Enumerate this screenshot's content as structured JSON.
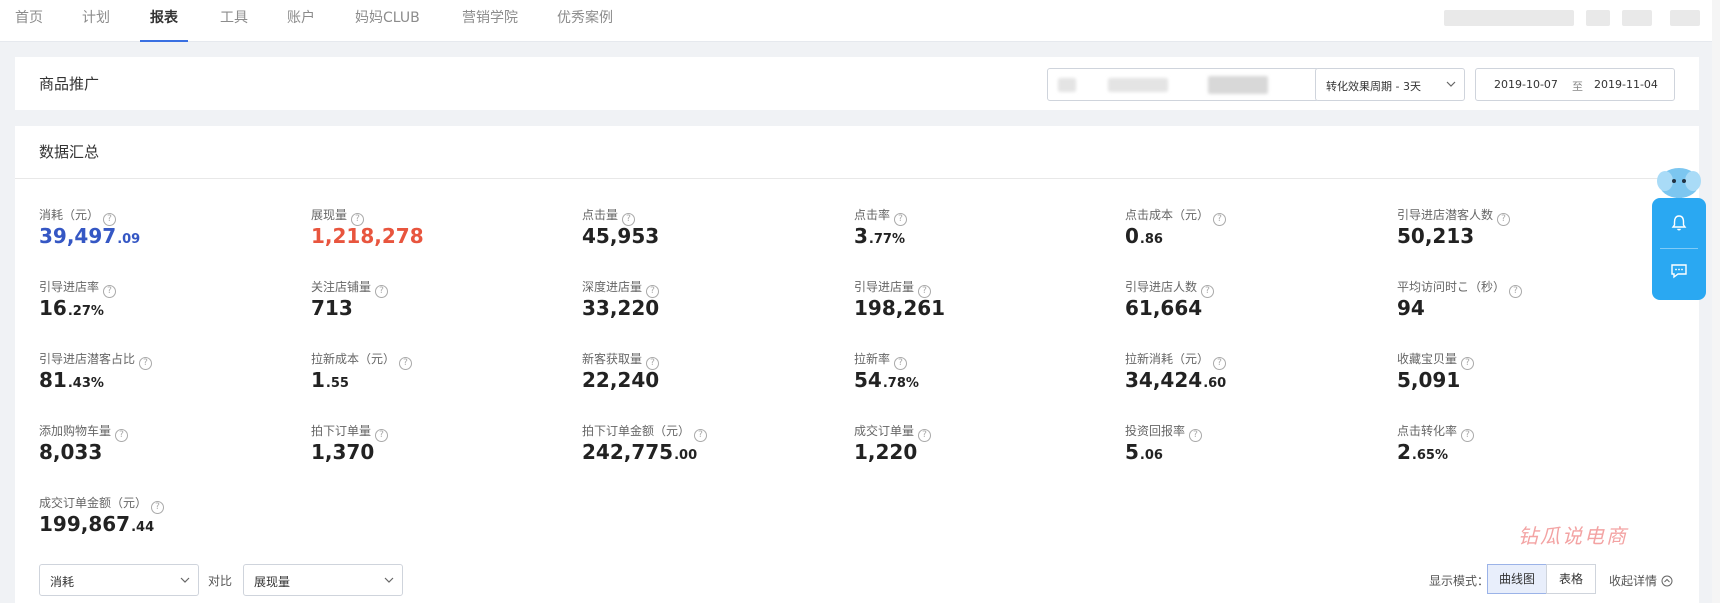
{
  "nav": {
    "items": [
      "首页",
      "计划",
      "报表",
      "工具",
      "账户",
      "妈妈CLUB",
      "营销学院",
      "优秀案例"
    ],
    "active_index": 2
  },
  "header": {
    "title": "商品推广",
    "period_select": "转化效果周期 - 3天",
    "date_start": "2019-10-07",
    "date_sep": "至",
    "date_end": "2019-11-04"
  },
  "summary": {
    "title": "数据汇总",
    "metrics": [
      {
        "label": "消耗（元）",
        "int": "39,497",
        "dec": ".09",
        "color": "#3557c4"
      },
      {
        "label": "展现量",
        "int": "1,218,278",
        "dec": "",
        "color": "#e8553e"
      },
      {
        "label": "点击量",
        "int": "45,953",
        "dec": "",
        "color": "#222222"
      },
      {
        "label": "点击率",
        "int": "3",
        "dec": ".77%",
        "color": "#222222"
      },
      {
        "label": "点击成本（元）",
        "int": "0",
        "dec": ".86",
        "color": "#222222"
      },
      {
        "label": "引导进店潜客人数",
        "int": "50,213",
        "dec": "",
        "color": "#222222"
      },
      {
        "label": "引导进店率",
        "int": "16",
        "dec": ".27%",
        "color": "#222222"
      },
      {
        "label": "关注店铺量",
        "int": "713",
        "dec": "",
        "color": "#222222"
      },
      {
        "label": "深度进店量",
        "int": "33,220",
        "dec": "",
        "color": "#222222"
      },
      {
        "label": "引导进店量",
        "int": "198,261",
        "dec": "",
        "color": "#222222"
      },
      {
        "label": "引导进店人数",
        "int": "61,664",
        "dec": "",
        "color": "#222222"
      },
      {
        "label": "平均访问时こ（秒）",
        "int": "94",
        "dec": "",
        "color": "#222222"
      },
      {
        "label": "引导进店潜客占比",
        "int": "81",
        "dec": ".43%",
        "color": "#222222"
      },
      {
        "label": "拉新成本（元）",
        "int": "1",
        "dec": ".55",
        "color": "#222222"
      },
      {
        "label": "新客获取量",
        "int": "22,240",
        "dec": "",
        "color": "#222222"
      },
      {
        "label": "拉新率",
        "int": "54",
        "dec": ".78%",
        "color": "#222222"
      },
      {
        "label": "拉新消耗（元）",
        "int": "34,424",
        "dec": ".60",
        "color": "#222222"
      },
      {
        "label": "收藏宝贝量",
        "int": "5,091",
        "dec": "",
        "color": "#222222"
      },
      {
        "label": "添加购物车量",
        "int": "8,033",
        "dec": "",
        "color": "#222222"
      },
      {
        "label": "拍下订单量",
        "int": "1,370",
        "dec": "",
        "color": "#222222"
      },
      {
        "label": "拍下订单金额（元）",
        "int": "242,775",
        "dec": ".00",
        "color": "#222222"
      },
      {
        "label": "成交订单量",
        "int": "1,220",
        "dec": "",
        "color": "#222222"
      },
      {
        "label": "投资回报率",
        "int": "5",
        "dec": ".06",
        "color": "#222222"
      },
      {
        "label": "点击转化率",
        "int": "2",
        "dec": ".65%",
        "color": "#222222"
      },
      {
        "label": "成交订单金额（元）",
        "int": "199,867",
        "dec": ".44",
        "color": "#222222"
      }
    ]
  },
  "controls": {
    "metric_a": "消耗",
    "compare_label": "对比",
    "metric_b": "展现量",
    "mode_label": "显示模式：",
    "mode_chart": "曲线图",
    "mode_table": "表格",
    "collapse": "收起详情"
  },
  "watermark": "钻瓜说电商",
  "icons": {
    "bell": "bell-icon",
    "chat": "chat-icon",
    "question": "question-icon",
    "chevron": "chevron-down-icon"
  }
}
